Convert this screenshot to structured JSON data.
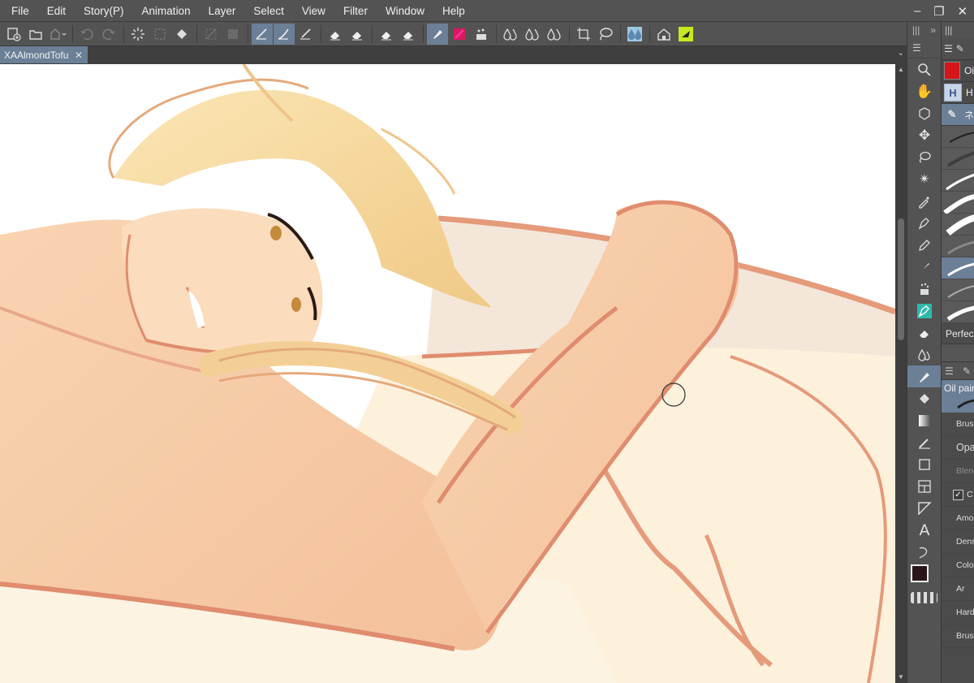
{
  "menu": [
    "File",
    "Edit",
    "Story(P)",
    "Animation",
    "Layer",
    "Select",
    "View",
    "Filter",
    "Window",
    "Help"
  ],
  "window_controls": [
    "–",
    "❐",
    "✕"
  ],
  "command_icons": [
    "new-icon",
    "open-icon",
    "save-icon",
    "undo-icon",
    "redo-icon",
    "loading-icon",
    "deselect-icon",
    "fill-icon",
    "transparent-icon",
    "transform-icon",
    "stabilize-icon",
    "pen-icon",
    "correct-line-icon",
    "eraser-icon",
    "eraser-icon",
    "eraser-icon",
    "eraser-icon",
    "blend-icon",
    "color-icon",
    "paint-icon",
    "drop-icon",
    "drop-icon",
    "drop-icon",
    "crop-icon",
    "lasso-icon",
    "water-icon",
    "home-icon",
    "ai-icon"
  ],
  "document_tab": {
    "title": "XAAlmondTofu",
    "close": "✕"
  },
  "tool_palette": {
    "header_left": "|||",
    "header_right": "»",
    "sub_header": "☰"
  },
  "right_panel": {
    "header_right": "|||",
    "subtool_groups": [
      {
        "label": "Oi",
        "icon": "red-brush-icon",
        "selected": false
      },
      {
        "label": "H",
        "icon": "h-icon",
        "selected": false
      },
      {
        "label": "ネ",
        "icon": "pen-group-icon",
        "selected": true
      }
    ],
    "brush_selected_name": "Perfect",
    "tool_property": {
      "preview_label": "Oil pain",
      "rows": [
        {
          "label": "Brush",
          "dim": false,
          "big": false
        },
        {
          "label": "Opa",
          "dim": false,
          "big": true
        },
        {
          "label": "Blend",
          "dim": true,
          "big": false
        },
        {
          "label": "C",
          "dim": false,
          "big": false,
          "checkbox": true
        },
        {
          "label": "Amou",
          "dim": false,
          "big": false
        },
        {
          "label": "Dens",
          "dim": false,
          "big": false
        },
        {
          "label": "Colo",
          "dim": false,
          "big": false
        },
        {
          "label": "Ar",
          "dim": false,
          "big": false
        },
        {
          "label": "Hard",
          "dim": false,
          "big": false
        },
        {
          "label": "Brush",
          "dim": false,
          "big": false
        }
      ]
    }
  },
  "colors": {
    "accent": "#6b7f97",
    "main_color": "#2a161a",
    "sub_color": "#ffffff"
  }
}
